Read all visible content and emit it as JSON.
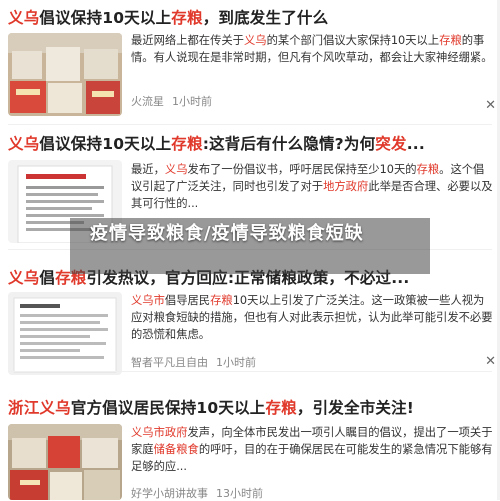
{
  "overlay": {
    "text": "疫情导致粮食/疫情导致粮食短缺"
  },
  "close_glyph": "✕",
  "articles": [
    {
      "title_parts": [
        "义乌",
        "倡议保持10天以上",
        "存粮",
        "，到底发生了什么"
      ],
      "snippet_parts": [
        "最近网络上都在传关于",
        "义乌",
        "的某个部门倡议大家保持10天以上",
        "存粮",
        "的事情。有人说现在是非常时期，但凡有个风吹草动，都会让大家神经绷紧。"
      ],
      "source": "火流星",
      "time": "1小时前"
    },
    {
      "title_parts": [
        "义乌",
        "倡议保持10天以上",
        "存粮",
        ":这背后有什么隐情?为何",
        "突发",
        "..."
      ],
      "snippet_parts": [
        "最近，",
        "义乌",
        "发布了一份倡议书，呼吁居民保持至少10天的",
        "存粮",
        "。这个倡议引起了广泛关注，同时也引发了对于",
        "地方政府",
        "此举是否合理、必要以及其可行性的..."
      ],
      "source": "",
      "time": ""
    },
    {
      "title_parts": [
        "义乌",
        "倡",
        "存粮",
        "引发热议，官方回应:正常储粮政策，不必过..."
      ],
      "snippet_parts": [
        "义乌市",
        "倡导居民",
        "存粮",
        "10天以上引发了广泛关注。这一政策被一些人视为应对粮食短缺的措施，但也有人对此表示担忧，认为此举可能引发不必要的恐慌和焦虑。"
      ],
      "source": "智者平凡且自由",
      "time": "1小时前"
    },
    {
      "title_parts": [
        "浙江义乌",
        "官方倡议居民保持10天以上",
        "存粮",
        "，引发全市关注!"
      ],
      "snippet_parts": [
        "义乌市政府",
        "发声，向全体市民发出一项引人瞩目的倡议，提出了一项关于家庭",
        "储备粮食",
        "的呼吁，目的在于确保居民在可能发生的紧急情况下能够有足够的应..."
      ],
      "source": "好学小胡讲故事",
      "time": "13小时前"
    }
  ],
  "colors": {
    "highlight": "#e0392b",
    "text": "#222222",
    "meta": "#888888"
  }
}
